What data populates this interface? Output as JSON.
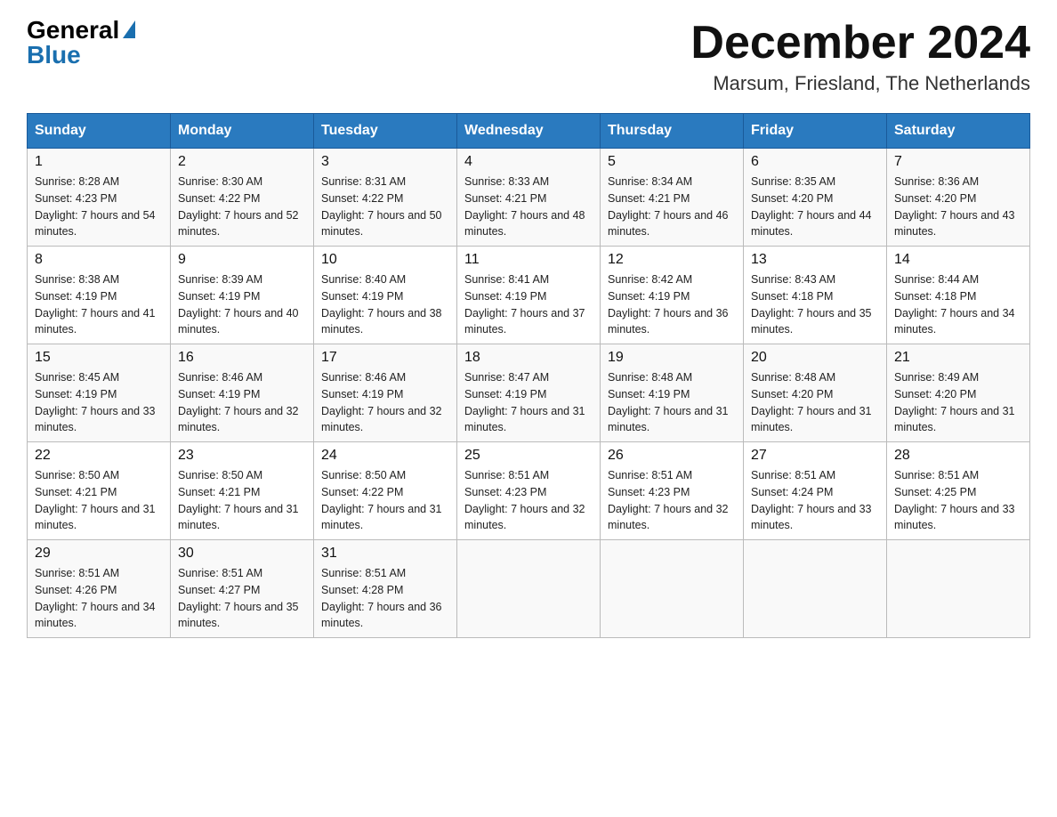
{
  "header": {
    "logo_general": "General",
    "logo_blue": "Blue",
    "month_title": "December 2024",
    "location": "Marsum, Friesland, The Netherlands"
  },
  "weekdays": [
    "Sunday",
    "Monday",
    "Tuesday",
    "Wednesday",
    "Thursday",
    "Friday",
    "Saturday"
  ],
  "weeks": [
    [
      {
        "day": "1",
        "sunrise": "8:28 AM",
        "sunset": "4:23 PM",
        "daylight": "7 hours and 54 minutes."
      },
      {
        "day": "2",
        "sunrise": "8:30 AM",
        "sunset": "4:22 PM",
        "daylight": "7 hours and 52 minutes."
      },
      {
        "day": "3",
        "sunrise": "8:31 AM",
        "sunset": "4:22 PM",
        "daylight": "7 hours and 50 minutes."
      },
      {
        "day": "4",
        "sunrise": "8:33 AM",
        "sunset": "4:21 PM",
        "daylight": "7 hours and 48 minutes."
      },
      {
        "day": "5",
        "sunrise": "8:34 AM",
        "sunset": "4:21 PM",
        "daylight": "7 hours and 46 minutes."
      },
      {
        "day": "6",
        "sunrise": "8:35 AM",
        "sunset": "4:20 PM",
        "daylight": "7 hours and 44 minutes."
      },
      {
        "day": "7",
        "sunrise": "8:36 AM",
        "sunset": "4:20 PM",
        "daylight": "7 hours and 43 minutes."
      }
    ],
    [
      {
        "day": "8",
        "sunrise": "8:38 AM",
        "sunset": "4:19 PM",
        "daylight": "7 hours and 41 minutes."
      },
      {
        "day": "9",
        "sunrise": "8:39 AM",
        "sunset": "4:19 PM",
        "daylight": "7 hours and 40 minutes."
      },
      {
        "day": "10",
        "sunrise": "8:40 AM",
        "sunset": "4:19 PM",
        "daylight": "7 hours and 38 minutes."
      },
      {
        "day": "11",
        "sunrise": "8:41 AM",
        "sunset": "4:19 PM",
        "daylight": "7 hours and 37 minutes."
      },
      {
        "day": "12",
        "sunrise": "8:42 AM",
        "sunset": "4:19 PM",
        "daylight": "7 hours and 36 minutes."
      },
      {
        "day": "13",
        "sunrise": "8:43 AM",
        "sunset": "4:18 PM",
        "daylight": "7 hours and 35 minutes."
      },
      {
        "day": "14",
        "sunrise": "8:44 AM",
        "sunset": "4:18 PM",
        "daylight": "7 hours and 34 minutes."
      }
    ],
    [
      {
        "day": "15",
        "sunrise": "8:45 AM",
        "sunset": "4:19 PM",
        "daylight": "7 hours and 33 minutes."
      },
      {
        "day": "16",
        "sunrise": "8:46 AM",
        "sunset": "4:19 PM",
        "daylight": "7 hours and 32 minutes."
      },
      {
        "day": "17",
        "sunrise": "8:46 AM",
        "sunset": "4:19 PM",
        "daylight": "7 hours and 32 minutes."
      },
      {
        "day": "18",
        "sunrise": "8:47 AM",
        "sunset": "4:19 PM",
        "daylight": "7 hours and 31 minutes."
      },
      {
        "day": "19",
        "sunrise": "8:48 AM",
        "sunset": "4:19 PM",
        "daylight": "7 hours and 31 minutes."
      },
      {
        "day": "20",
        "sunrise": "8:48 AM",
        "sunset": "4:20 PM",
        "daylight": "7 hours and 31 minutes."
      },
      {
        "day": "21",
        "sunrise": "8:49 AM",
        "sunset": "4:20 PM",
        "daylight": "7 hours and 31 minutes."
      }
    ],
    [
      {
        "day": "22",
        "sunrise": "8:50 AM",
        "sunset": "4:21 PM",
        "daylight": "7 hours and 31 minutes."
      },
      {
        "day": "23",
        "sunrise": "8:50 AM",
        "sunset": "4:21 PM",
        "daylight": "7 hours and 31 minutes."
      },
      {
        "day": "24",
        "sunrise": "8:50 AM",
        "sunset": "4:22 PM",
        "daylight": "7 hours and 31 minutes."
      },
      {
        "day": "25",
        "sunrise": "8:51 AM",
        "sunset": "4:23 PM",
        "daylight": "7 hours and 32 minutes."
      },
      {
        "day": "26",
        "sunrise": "8:51 AM",
        "sunset": "4:23 PM",
        "daylight": "7 hours and 32 minutes."
      },
      {
        "day": "27",
        "sunrise": "8:51 AM",
        "sunset": "4:24 PM",
        "daylight": "7 hours and 33 minutes."
      },
      {
        "day": "28",
        "sunrise": "8:51 AM",
        "sunset": "4:25 PM",
        "daylight": "7 hours and 33 minutes."
      }
    ],
    [
      {
        "day": "29",
        "sunrise": "8:51 AM",
        "sunset": "4:26 PM",
        "daylight": "7 hours and 34 minutes."
      },
      {
        "day": "30",
        "sunrise": "8:51 AM",
        "sunset": "4:27 PM",
        "daylight": "7 hours and 35 minutes."
      },
      {
        "day": "31",
        "sunrise": "8:51 AM",
        "sunset": "4:28 PM",
        "daylight": "7 hours and 36 minutes."
      },
      null,
      null,
      null,
      null
    ]
  ]
}
